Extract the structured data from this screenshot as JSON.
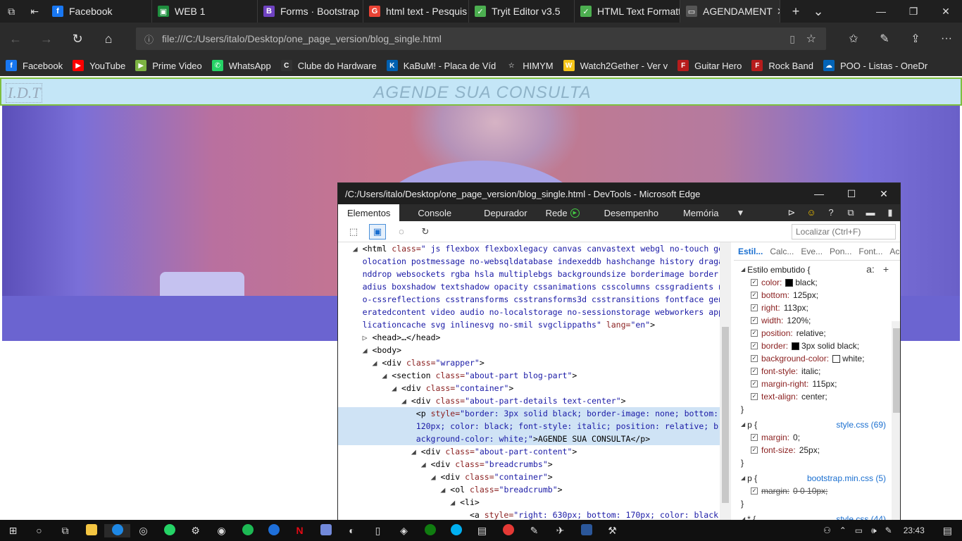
{
  "browser": {
    "tabs": [
      {
        "label": "Facebook",
        "icon": "facebook-icon",
        "color": "#1877f2",
        "glyph": "f"
      },
      {
        "label": "WEB 1",
        "icon": "classroom-icon",
        "color": "#1e8e3e",
        "glyph": "▣"
      },
      {
        "label": "Forms · Bootstrap",
        "icon": "bootstrap-icon",
        "color": "#6f42c1",
        "glyph": "B"
      },
      {
        "label": "html text - Pesquis",
        "icon": "google-icon",
        "color": "#ea4335",
        "glyph": "G"
      },
      {
        "label": "Tryit Editor v3.5",
        "icon": "w3schools-icon",
        "color": "#4caf50",
        "glyph": "✓"
      },
      {
        "label": "HTML Text Formatt",
        "icon": "w3schools-icon",
        "color": "#4caf50",
        "glyph": "✓"
      },
      {
        "label": "AGENDAMENT",
        "icon": "page-icon",
        "color": "#555555",
        "glyph": "▭"
      }
    ],
    "url": "file:///C:/Users/italo/Desktop/one_page_version/blog_single.html",
    "favorites": [
      {
        "label": "Facebook",
        "color": "#1877f2",
        "glyph": "f"
      },
      {
        "label": "YouTube",
        "color": "#ff0000",
        "glyph": "▶"
      },
      {
        "label": "Prime Video",
        "color": "#7cb342",
        "glyph": "▶"
      },
      {
        "label": "WhatsApp",
        "color": "#25d366",
        "glyph": "✆"
      },
      {
        "label": "Clube do Hardware",
        "color": "#333333",
        "glyph": "C"
      },
      {
        "label": "KaBuM! - Placa de Víd",
        "color": "#0060b1",
        "glyph": "K"
      },
      {
        "label": "HIMYM",
        "color": "#2b2b2b",
        "glyph": "☆"
      },
      {
        "label": "Watch2Gether - Ver v",
        "color": "#f5c518",
        "glyph": "W"
      },
      {
        "label": "Guitar Hero",
        "color": "#b71c1c",
        "glyph": "F"
      },
      {
        "label": "Rock Band",
        "color": "#b71c1c",
        "glyph": "F"
      },
      {
        "label": "POO - Listas - OneDr",
        "color": "#0364b8",
        "glyph": "☁"
      }
    ]
  },
  "page": {
    "logo": "I.D.T",
    "title": "AGENDE SUA CONSULTA"
  },
  "devtools": {
    "title": "/C:/Users/italo/Desktop/one_page_version/blog_single.html - DevTools - Microsoft Edge",
    "tabs": [
      "Elementos",
      "Console",
      "Depurador",
      "Rede",
      "Desempenho",
      "Memória"
    ],
    "find_placeholder": "Localizar (Ctrl+F)",
    "style_tabs": [
      "Estil...",
      "Calc...",
      "Eve...",
      "Pon...",
      "Font...",
      "Ace..."
    ],
    "rules": [
      {
        "selector": "Estilo embutido {",
        "source": "",
        "props": [
          {
            "name": "color:",
            "value": "black;",
            "swatch": "#000000"
          },
          {
            "name": "bottom:",
            "value": "125px;"
          },
          {
            "name": "right:",
            "value": "113px;"
          },
          {
            "name": "width:",
            "value": "120%;"
          },
          {
            "name": "position:",
            "value": "relative;"
          },
          {
            "name": "border:",
            "value": "3px solid black;",
            "swatch": "#000000"
          },
          {
            "name": "background-color:",
            "value": "white;",
            "swatch": "#ffffff"
          },
          {
            "name": "font-style:",
            "value": "italic;"
          },
          {
            "name": "margin-right:",
            "value": "115px;"
          },
          {
            "name": "text-align:",
            "value": "center;"
          }
        ]
      },
      {
        "selector": "p {",
        "source": "style.css (69)",
        "props": [
          {
            "name": "margin:",
            "value": "0;"
          },
          {
            "name": "font-size:",
            "value": "25px;"
          }
        ]
      },
      {
        "selector": "p {",
        "source": "bootstrap.min.css (5)",
        "props": [
          {
            "name": "margin:",
            "value": "0 0 10px;",
            "strike": true
          }
        ]
      },
      {
        "selector": "* {",
        "source": "style.css (44)",
        "props": []
      }
    ]
  },
  "taskbar": {
    "time": "23:43"
  }
}
